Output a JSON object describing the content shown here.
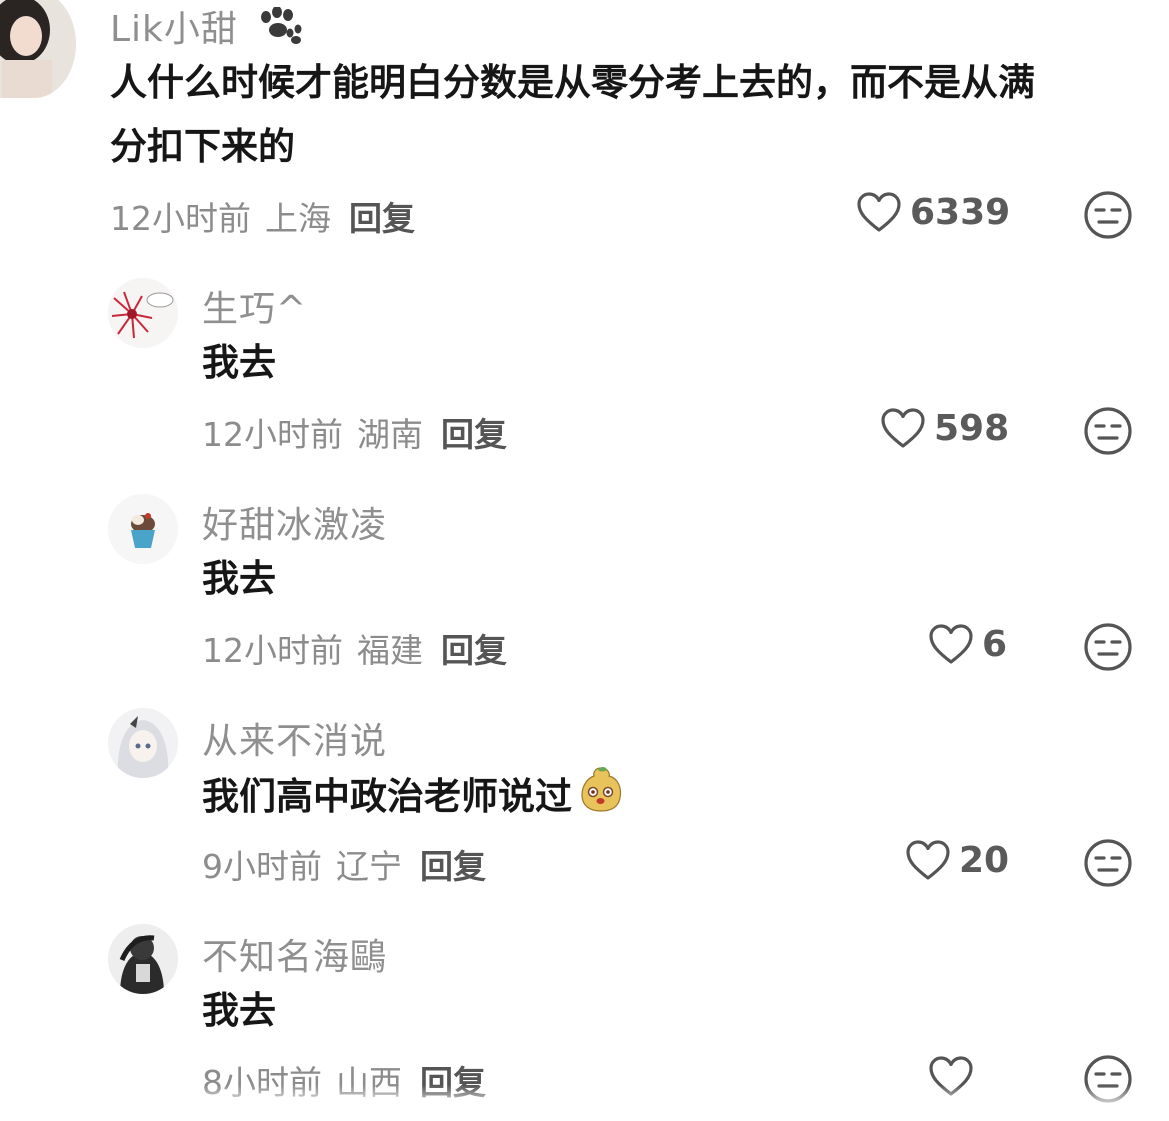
{
  "comments": [
    {
      "username": "Lik小甜",
      "text_lines": [
        "人什么时候才能明白分数是从零分考上去的，而不是从满",
        "分扣下来的"
      ],
      "time": "12小时前",
      "location": "上海",
      "reply_label": "回复",
      "likes": "6339"
    },
    {
      "username": "生巧^",
      "text": "我去",
      "time": "12小时前",
      "location": "湖南",
      "reply_label": "回复",
      "likes": "598"
    },
    {
      "username": "好甜冰激凌",
      "text": "我去",
      "time": "12小时前",
      "location": "福建",
      "reply_label": "回复",
      "likes": "6"
    },
    {
      "username": "从来不消说",
      "text": "我们高中政治老师说过",
      "time": "9小时前",
      "location": "辽宁",
      "reply_label": "回复",
      "likes": "20"
    },
    {
      "username": "不知名海鷗",
      "text": "我去",
      "time": "8小时前",
      "location": "山西",
      "reply_label": "回复",
      "likes": ""
    }
  ],
  "icons": {
    "like": "heart-outline-icon",
    "dislike": "neutral-face-icon",
    "badge": "paw-print-icon",
    "inline_emoji": "potato-face-emoji"
  },
  "colors": {
    "username": "#8f8f8f",
    "meta": "#8c8c8c",
    "icon": "#555555"
  }
}
